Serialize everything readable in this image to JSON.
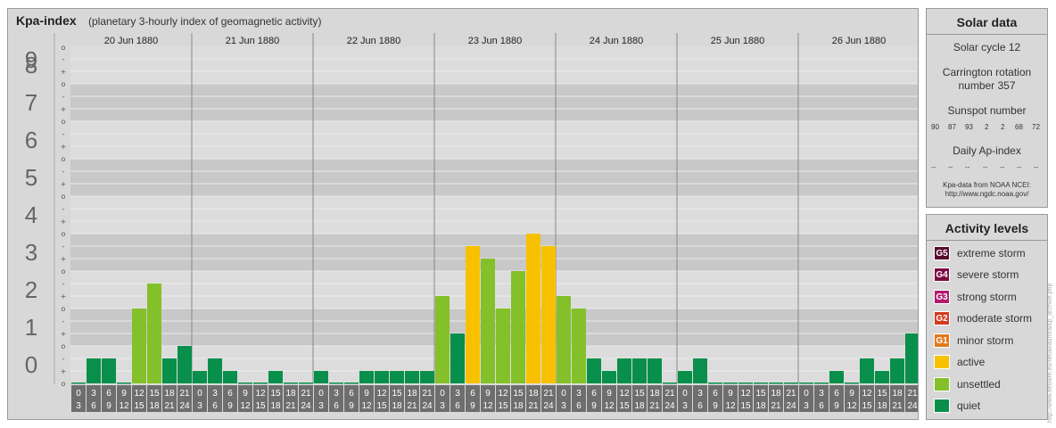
{
  "header": {
    "title": "Kpa-index",
    "subtitle": "(planetary 3-hourly index of geomagnetic activity)"
  },
  "chart_data": {
    "type": "bar",
    "title": "Kpa-index",
    "subtitle": "(planetary 3-hourly index of geomagnetic activity)",
    "ylim": [
      0,
      9
    ],
    "y_ticks": [
      "0",
      "1",
      "2",
      "3",
      "4",
      "5",
      "6",
      "7",
      "8",
      "9"
    ],
    "sub_ticks": [
      "o",
      "+",
      "-"
    ],
    "days": [
      "20 Jun 1880",
      "21 Jun 1880",
      "22 Jun 1880",
      "23 Jun 1880",
      "24 Jun 1880",
      "25 Jun 1880",
      "26 Jun 1880"
    ],
    "interval_top": [
      "0",
      "3",
      "6",
      "9",
      "12",
      "15",
      "18",
      "21"
    ],
    "interval_bottom": [
      "3",
      "6",
      "9",
      "12",
      "15",
      "18",
      "21",
      "24"
    ],
    "values": [
      [
        0,
        0.667,
        0.667,
        0,
        2,
        2.667,
        0.667,
        1
      ],
      [
        0.333,
        0.667,
        0.333,
        0,
        0,
        0.333,
        0,
        0
      ],
      [
        0.333,
        0,
        0,
        0.333,
        0.333,
        0.333,
        0.333,
        0.333
      ],
      [
        2.333,
        1.333,
        3.667,
        3.333,
        2,
        3,
        4,
        3.667
      ],
      [
        2.333,
        2,
        0.667,
        0.333,
        0.667,
        0.667,
        0.667,
        0
      ],
      [
        0.333,
        0.667,
        0,
        0,
        0,
        0,
        0,
        0
      ],
      [
        0,
        0,
        0.333,
        0,
        0.667,
        0.333,
        0.667,
        1.333
      ]
    ],
    "levels": [
      "quiet",
      "unsettled",
      "active"
    ],
    "colors": {
      "quiet": "#078f4b",
      "unsettled": "#84c02a",
      "active": "#f7c100"
    },
    "grid": true
  },
  "solar": {
    "title": "Solar data",
    "solar_cycle": "Solar cycle 12",
    "carrington_line1": "Carrington rotation",
    "carrington_line2": "number 357",
    "sunspot_label": "Sunspot number",
    "sunspot_values": [
      "90",
      "87",
      "93",
      "2",
      "2",
      "68",
      "72"
    ],
    "ap_label": "Daily Ap-index",
    "ap_values": [
      "--",
      "--",
      "--",
      "--",
      "--",
      "--",
      "--"
    ],
    "source_line1": "Kpa-data from NOAA NCEI:",
    "source_line2": "http://www.ngdc.noaa.gov/"
  },
  "activity": {
    "title": "Activity levels",
    "levels": [
      {
        "code": "G5",
        "label": "extreme storm",
        "color": "#5a0a2e"
      },
      {
        "code": "G4",
        "label": "severe storm",
        "color": "#7d0a44"
      },
      {
        "code": "G3",
        "label": "strong storm",
        "color": "#b21a6c"
      },
      {
        "code": "G2",
        "label": "moderate storm",
        "color": "#d43a1f"
      },
      {
        "code": "G1",
        "label": "minor storm",
        "color": "#e3781d"
      },
      {
        "code": "",
        "label": "active",
        "color": "#f7c100"
      },
      {
        "code": "",
        "label": "unsettled",
        "color": "#84c02a"
      },
      {
        "code": "",
        "label": "quiet",
        "color": "#078f4b"
      }
    ]
  },
  "watermark": "http://www.fieuwre.eu/fieuw/aurora/kp_archive.php"
}
